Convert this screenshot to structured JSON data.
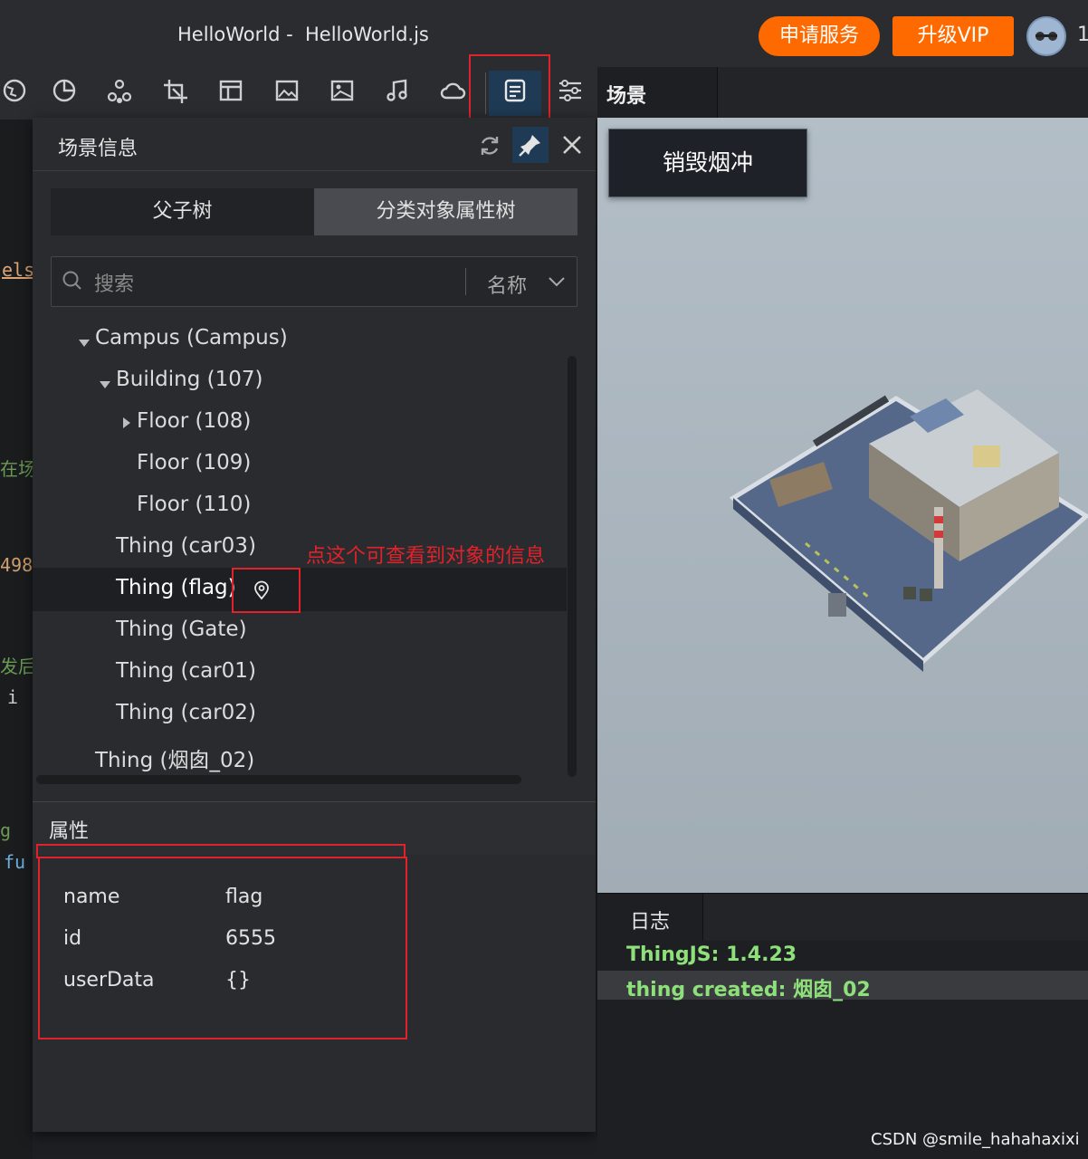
{
  "window": {
    "title": "HelloWorld -  HelloWorld.js",
    "service_button": "申请服务",
    "vip_button": "升级VIP",
    "avatar_edge_text": "1"
  },
  "toolbar": {
    "icons": [
      "globe-icon",
      "pie-chart-icon",
      "hierarchy-icon",
      "crop-icon",
      "layout-icon",
      "image-icon",
      "photo-icon",
      "music-icon",
      "cloud-icon",
      "scene-info-icon",
      "sliders-icon"
    ]
  },
  "editor_fragments": [
    "els",
    "在场",
    "498",
    "发后",
    "i",
    "g",
    "fu"
  ],
  "scene_panel": {
    "title": "场景信息",
    "tabs": [
      "父子树",
      "分类对象属性树"
    ],
    "search_placeholder": "搜索",
    "filter_label": "名称",
    "tree": [
      {
        "label": "Campus (Campus)",
        "expanded": true
      },
      {
        "label": "Building (107)",
        "expanded": true
      },
      {
        "label": "Floor (108)",
        "collapsed": true
      },
      {
        "label": "Floor (109)"
      },
      {
        "label": "Floor (110)"
      },
      {
        "label": "Thing (car03)"
      },
      {
        "label": "Thing (flag)",
        "selected": true
      },
      {
        "label": "Thing (Gate)"
      },
      {
        "label": "Thing (car01)"
      },
      {
        "label": "Thing (car02)"
      },
      {
        "label": "Thing (烟囱_02)"
      }
    ],
    "annotation": "点这个可查看到对象的信息"
  },
  "properties": {
    "title": "属性",
    "rows": [
      {
        "key": "name",
        "value": "flag"
      },
      {
        "key": "id",
        "value": "6555"
      },
      {
        "key": "userData",
        "value": "{}"
      }
    ]
  },
  "scene": {
    "tab_label": "场景",
    "destroy_button": "销毁烟冲"
  },
  "log": {
    "tab_label": "日志",
    "lines": [
      "ThingJS: 1.4.23",
      "thing created: 烟囱_02"
    ]
  },
  "watermark": "CSDN @smile_hahahaxixi",
  "colors": {
    "accent_orange": "#ff6a00",
    "log_green": "#8ee07a",
    "highlight_red": "#e0232b"
  }
}
